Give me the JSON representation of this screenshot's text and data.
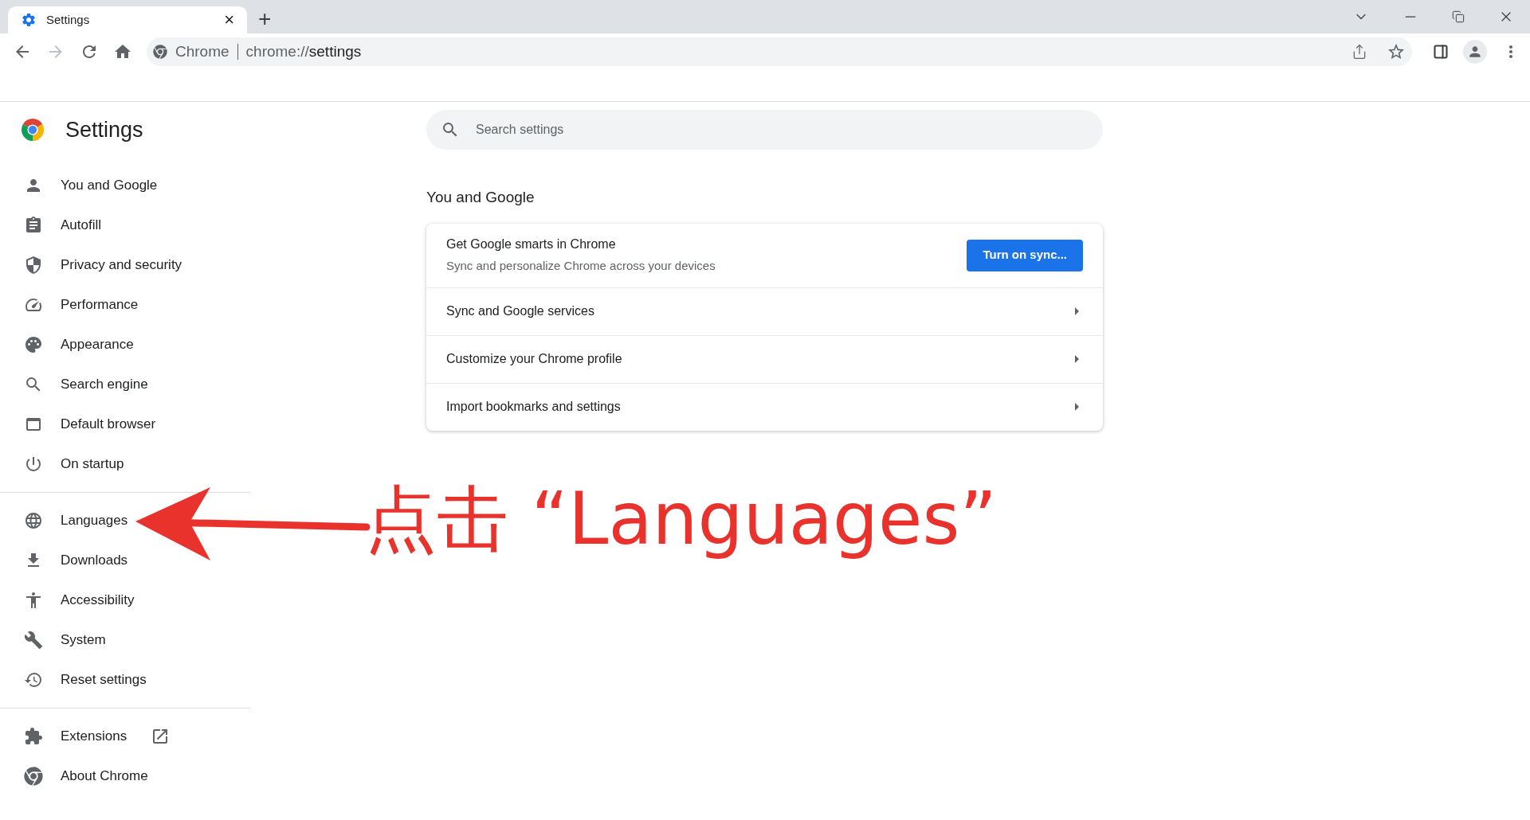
{
  "tab": {
    "title": "Settings",
    "close": "×",
    "new_tab": "+"
  },
  "address": {
    "site": "Chrome",
    "url_prefix": "chrome://",
    "url_path": "settings"
  },
  "header": {
    "title": "Settings"
  },
  "search": {
    "placeholder": "Search settings"
  },
  "sidebar": {
    "groups": [
      [
        {
          "label": "You and Google",
          "selected": false
        },
        {
          "label": "Autofill",
          "selected": false
        },
        {
          "label": "Privacy and security",
          "selected": false
        },
        {
          "label": "Performance",
          "selected": false
        },
        {
          "label": "Appearance",
          "selected": false
        },
        {
          "label": "Search engine",
          "selected": false
        },
        {
          "label": "Default browser",
          "selected": false
        },
        {
          "label": "On startup",
          "selected": false
        }
      ],
      [
        {
          "label": "Languages",
          "selected": false
        },
        {
          "label": "Downloads",
          "selected": false
        },
        {
          "label": "Accessibility",
          "selected": false
        },
        {
          "label": "System",
          "selected": false
        },
        {
          "label": "Reset settings",
          "selected": false
        }
      ],
      [
        {
          "label": "Extensions",
          "selected": false,
          "external_link": true
        },
        {
          "label": "About Chrome",
          "selected": false,
          "external_link": false
        }
      ]
    ]
  },
  "section": {
    "title": "You and Google",
    "sync_row": {
      "title": "Get Google smarts in Chrome",
      "subtitle": "Sync and personalize Chrome across your devices",
      "button": "Turn on sync..."
    },
    "rows": [
      {
        "label": "Sync and Google services"
      },
      {
        "label": "Customize your Chrome profile"
      },
      {
        "label": "Import bookmarks and settings"
      }
    ]
  },
  "annotation": {
    "text": "点击 “Languages”"
  }
}
